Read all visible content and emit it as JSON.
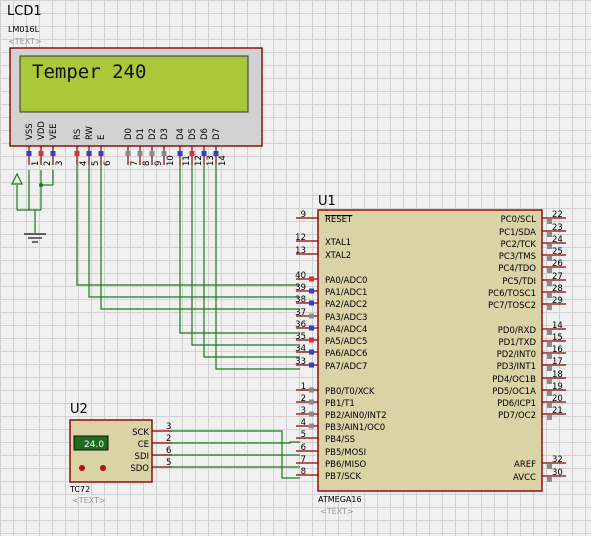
{
  "lcd": {
    "ref": "LCD1",
    "part": "LM016L",
    "text_tag": "<TEXT>",
    "display_text": "Temper 240",
    "pins": [
      {
        "num": "1",
        "name": "VSS",
        "state": "blue"
      },
      {
        "num": "2",
        "name": "VDD",
        "state": "red"
      },
      {
        "num": "3",
        "name": "VEE",
        "state": "blue"
      },
      {
        "num": "4",
        "name": "RS",
        "state": "red"
      },
      {
        "num": "5",
        "name": "RW",
        "state": "blue"
      },
      {
        "num": "6",
        "name": "E",
        "state": "blue"
      },
      {
        "num": "7",
        "name": "D0",
        "state": "grey"
      },
      {
        "num": "8",
        "name": "D1",
        "state": "grey"
      },
      {
        "num": "9",
        "name": "D2",
        "state": "grey"
      },
      {
        "num": "10",
        "name": "D3",
        "state": "grey"
      },
      {
        "num": "11",
        "name": "D4",
        "state": "blue"
      },
      {
        "num": "12",
        "name": "D5",
        "state": "red"
      },
      {
        "num": "13",
        "name": "D6",
        "state": "blue"
      },
      {
        "num": "14",
        "name": "D7",
        "state": "blue"
      }
    ]
  },
  "mcu": {
    "ref": "U1",
    "part": "ATMEGA16",
    "text_tag": "<TEXT>",
    "left_pins": [
      {
        "num": "9",
        "name": "RESET",
        "overline": true,
        "state": "none"
      },
      {
        "num": "12",
        "name": "XTAL1",
        "state": "none"
      },
      {
        "num": "13",
        "name": "XTAL2",
        "state": "none"
      },
      {
        "num": "40",
        "name": "PA0/ADC0",
        "state": "red"
      },
      {
        "num": "39",
        "name": "PA1/ADC1",
        "state": "blue"
      },
      {
        "num": "38",
        "name": "PA2/ADC2",
        "state": "blue"
      },
      {
        "num": "37",
        "name": "PA3/ADC3",
        "state": "grey"
      },
      {
        "num": "36",
        "name": "PA4/ADC4",
        "state": "blue"
      },
      {
        "num": "35",
        "name": "PA5/ADC5",
        "state": "red"
      },
      {
        "num": "34",
        "name": "PA6/ADC6",
        "state": "blue"
      },
      {
        "num": "33",
        "name": "PA7/ADC7",
        "state": "blue"
      },
      {
        "num": "1",
        "name": "PB0/T0/XCK",
        "state": "grey"
      },
      {
        "num": "2",
        "name": "PB1/T1",
        "state": "grey"
      },
      {
        "num": "3",
        "name": "PB2/AIN0/INT2",
        "state": "grey"
      },
      {
        "num": "4",
        "name": "PB3/AIN1/OC0",
        "state": "grey"
      },
      {
        "num": "5",
        "name": "PB4/SS",
        "state": "none"
      },
      {
        "num": "6",
        "name": "PB5/MOSI",
        "state": "none"
      },
      {
        "num": "7",
        "name": "PB6/MISO",
        "state": "none"
      },
      {
        "num": "8",
        "name": "PB7/SCK",
        "state": "none"
      }
    ],
    "right_pins": [
      {
        "num": "22",
        "name": "PC0/SCL"
      },
      {
        "num": "23",
        "name": "PC1/SDA"
      },
      {
        "num": "24",
        "name": "PC2/TCK"
      },
      {
        "num": "25",
        "name": "PC3/TMS"
      },
      {
        "num": "26",
        "name": "PC4/TDO"
      },
      {
        "num": "27",
        "name": "PC5/TDI"
      },
      {
        "num": "28",
        "name": "PC6/TOSC1"
      },
      {
        "num": "29",
        "name": "PC7/TOSC2"
      },
      {
        "num": "14",
        "name": "PD0/RXD"
      },
      {
        "num": "15",
        "name": "PD1/TXD"
      },
      {
        "num": "16",
        "name": "PD2/INT0"
      },
      {
        "num": "17",
        "name": "PD3/INT1"
      },
      {
        "num": "18",
        "name": "PD4/OC1B"
      },
      {
        "num": "19",
        "name": "PD5/OC1A"
      },
      {
        "num": "20",
        "name": "PD6/ICP1"
      },
      {
        "num": "21",
        "name": "PD7/OC2"
      },
      {
        "num": "32",
        "name": "AREF"
      },
      {
        "num": "30",
        "name": "AVCC"
      }
    ]
  },
  "sensor": {
    "ref": "U2",
    "part": "TC72",
    "text_tag": "<TEXT>",
    "display_value": "24.0",
    "pins": [
      {
        "num": "3",
        "name": "SCK"
      },
      {
        "num": "2",
        "name": "CE"
      },
      {
        "num": "6",
        "name": "SDI"
      },
      {
        "num": "5",
        "name": "SDO"
      }
    ]
  },
  "colors": {
    "wire": "#1a7a1a",
    "component_outline": "#8a0000",
    "component_body": "#d9d3a6",
    "lcd_screen": "#a9c83a",
    "state_high": "#e23030",
    "state_low": "#2b3fe0",
    "state_float": "#8a8a8a"
  }
}
